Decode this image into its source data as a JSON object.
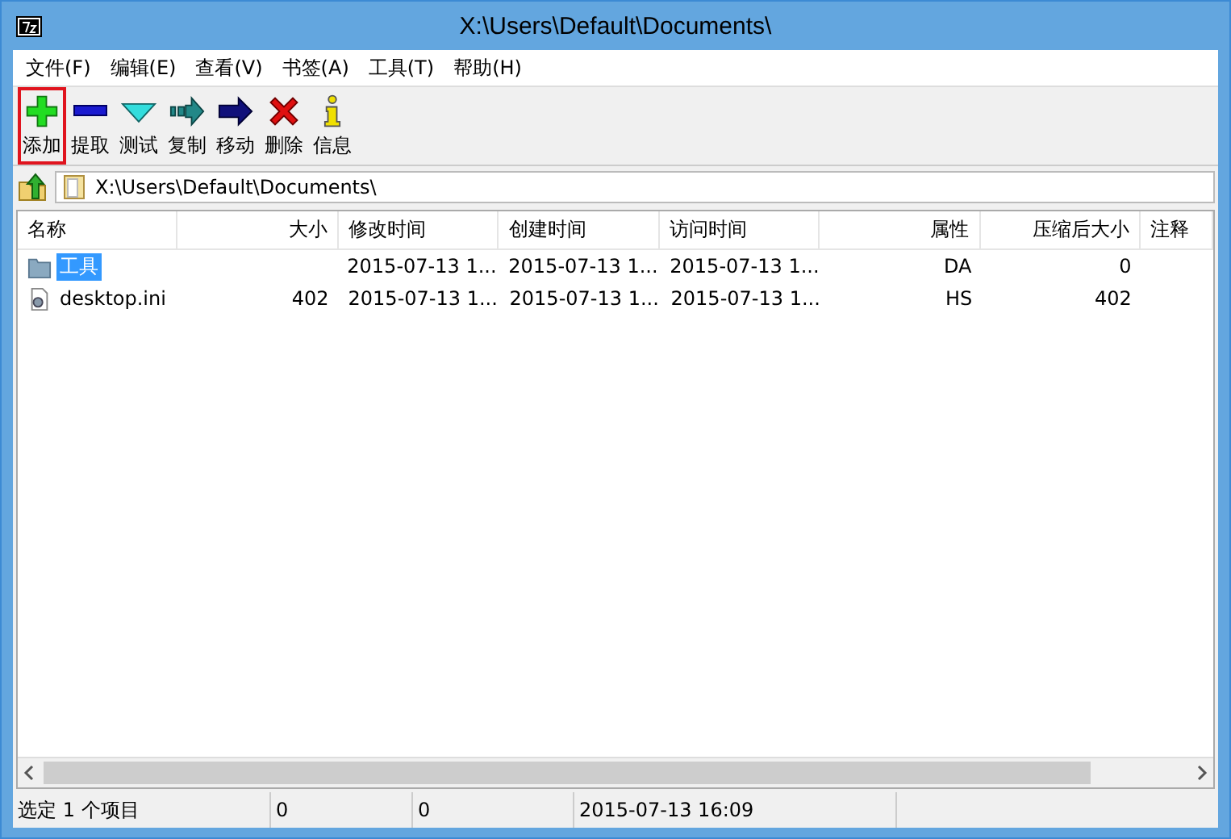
{
  "window": {
    "title": "X:\\Users\\Default\\Documents\\"
  },
  "menu": [
    "文件(F)",
    "编辑(E)",
    "查看(V)",
    "书签(A)",
    "工具(T)",
    "帮助(H)"
  ],
  "toolbar": [
    {
      "kind": "add",
      "label": "添加",
      "highlighted": true
    },
    {
      "kind": "extract",
      "label": "提取",
      "highlighted": false
    },
    {
      "kind": "test",
      "label": "测试",
      "highlighted": false
    },
    {
      "kind": "copy",
      "label": "复制",
      "highlighted": false
    },
    {
      "kind": "move",
      "label": "移动",
      "highlighted": false
    },
    {
      "kind": "delete",
      "label": "删除",
      "highlighted": false
    },
    {
      "kind": "info",
      "label": "信息",
      "highlighted": false
    }
  ],
  "address": {
    "value": "X:\\Users\\Default\\Documents\\"
  },
  "table": {
    "columns": [
      "名称",
      "大小",
      "修改时间",
      "创建时间",
      "访问时间",
      "属性",
      "压缩后大小",
      "注释"
    ],
    "rows": [
      {
        "kind": "folder",
        "selected": true,
        "cells": [
          "工具",
          "",
          "2015-07-13 1...",
          "2015-07-13 1...",
          "2015-07-13 1...",
          "DA",
          "0",
          ""
        ]
      },
      {
        "kind": "file",
        "selected": false,
        "cells": [
          "desktop.ini",
          "402",
          "2015-07-13 1...",
          "2015-07-13 1...",
          "2015-07-13 1...",
          "HS",
          "402",
          ""
        ]
      }
    ]
  },
  "status_bar": [
    "选定 1 个项目",
    "0",
    "0",
    "2015-07-13 16:09"
  ]
}
